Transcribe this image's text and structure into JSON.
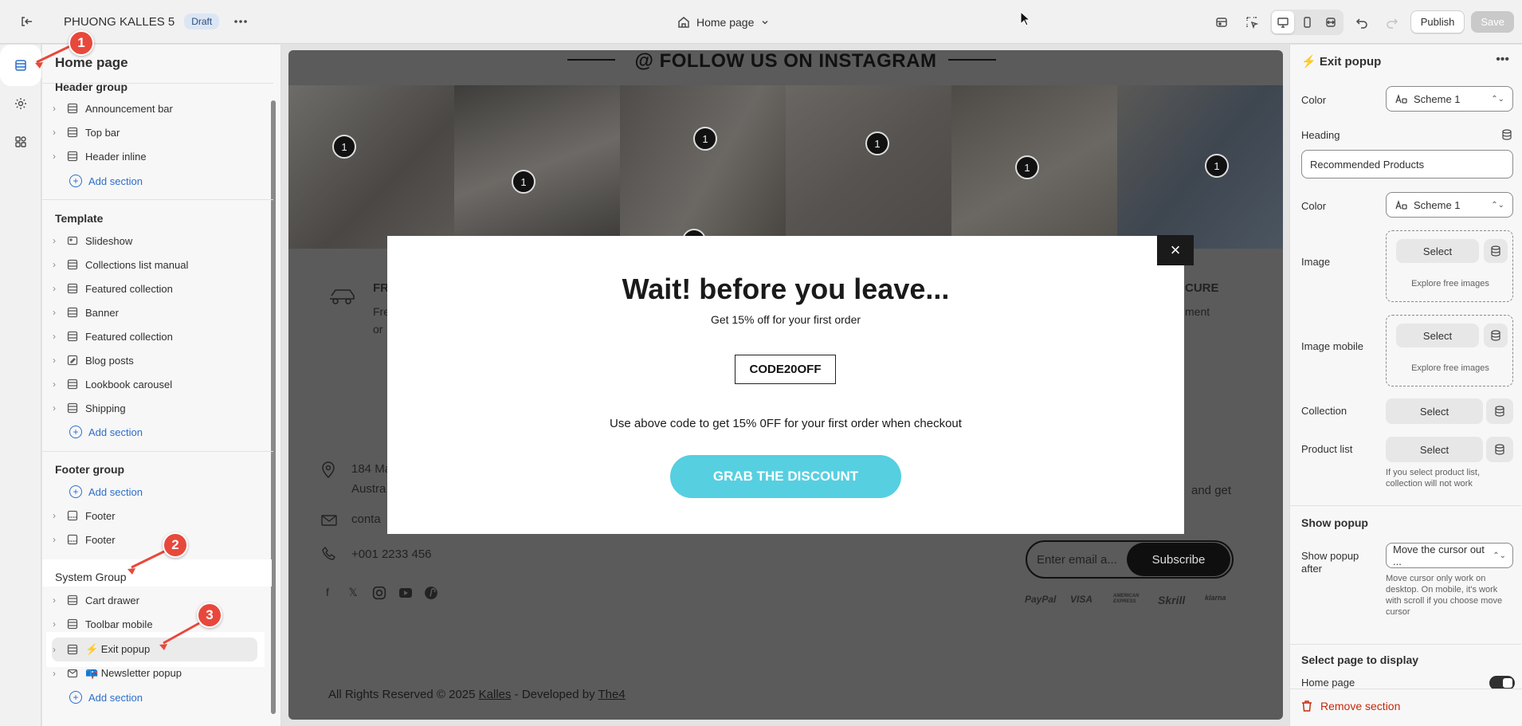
{
  "topbar": {
    "store_name": "PHUONG KALLES 5",
    "status_badge": "Draft",
    "page_selector": "Home page",
    "publish": "Publish",
    "save": "Save"
  },
  "sidebar": {
    "title": "Home page",
    "header_group": {
      "label": "Header group",
      "items": [
        "Announcement bar",
        "Top bar",
        "Header inline"
      ],
      "add": "Add section"
    },
    "template": {
      "label": "Template",
      "items": [
        "Slideshow",
        "Collections list manual",
        "Featured collection",
        "Banner",
        "Featured collection",
        "Blog posts",
        "Lookbook carousel",
        "Shipping"
      ],
      "add": "Add section"
    },
    "footer_group": {
      "label": "Footer group",
      "add": "Add section",
      "items": [
        "Footer",
        "Footer"
      ]
    },
    "system_group": {
      "label": "System Group",
      "items": [
        "Cart drawer",
        "Toolbar mobile",
        "⚡ Exit popup",
        "📪 Newsletter popup"
      ],
      "add": "Add section"
    }
  },
  "preview": {
    "instagram_title": "@ FOLLOW US ON INSTAGRAM",
    "pins": [
      "1",
      "1",
      "1",
      "1",
      "1",
      "1",
      "2"
    ],
    "feature_left": "FR",
    "feature_left_sub1": "Fre",
    "feature_left_sub2": "or ",
    "feature_right": "CURE",
    "feature_right_sub": "ment",
    "address1": "184 Ma",
    "address2": "Austra",
    "email_partial": "conta",
    "phone": "+001 2233 456",
    "and_get": "and get",
    "newsletter_placeholder": "Enter email a...",
    "subscribe": "Subscribe",
    "payments": [
      "PayPal",
      "VISA",
      "AMERICAN EXPRESS",
      "Skrill",
      "klarna"
    ],
    "copyright_prefix": "All Rights Reserved © 2025 ",
    "copyright_brand": "Kalles",
    "copyright_mid": " - Developed by ",
    "copyright_dev": "The4",
    "popup": {
      "heading": "Wait! before you leave...",
      "subheading": "Get 15% off for your first order",
      "code": "CODE20OFF",
      "instruction": "Use above code to get 15% 0FF for your first order when checkout",
      "button": "GRAB THE DISCOUNT",
      "close": "×"
    }
  },
  "panel": {
    "title": "⚡ Exit popup",
    "color_label": "Color",
    "color_value": "Scheme 1",
    "heading_label": "Heading",
    "heading_value": "Recommended Products",
    "color2_label": "Color",
    "color2_value": "Scheme 1",
    "image_label": "Image",
    "image_select": "Select",
    "image_explore": "Explore free images",
    "image_mobile_label": "Image mobile",
    "image_mobile_select": "Select",
    "image_mobile_explore": "Explore free images",
    "collection_label": "Collection",
    "collection_select": "Select",
    "product_list_label": "Product list",
    "product_list_select": "Select",
    "product_list_help": "If you select product list, collection will not work",
    "show_popup_heading": "Show popup",
    "show_after_label": "Show popup after",
    "show_after_value": "Move the cursor out ...",
    "show_after_help": "Move cursor only work on desktop. On mobile, it's work with scroll if you choose move cursor",
    "select_page_heading": "Select page to display",
    "home_page_label": "Home page",
    "remove": "Remove section"
  },
  "annotations": [
    "1",
    "2",
    "3"
  ],
  "colors": {
    "accent": "#2c6ecb",
    "discount_button": "#56cfe1",
    "marker": "#e8483b",
    "remove": "#c5280c"
  }
}
